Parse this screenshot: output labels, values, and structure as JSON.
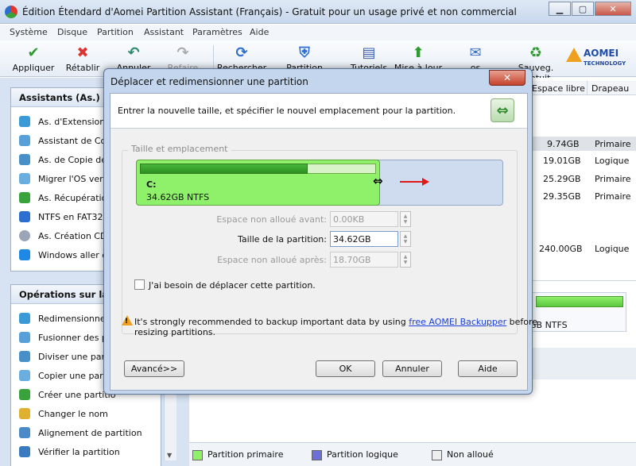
{
  "window": {
    "title": "Édition Étendard d'Aomei Partition Assistant (Français) - Gratuit pour un usage privé et non commercial"
  },
  "menu": [
    "Système",
    "Disque",
    "Partition",
    "Assistant",
    "Paramètres",
    "Aide"
  ],
  "toolbar": {
    "apply": "Appliquer",
    "reset": "Rétablir",
    "undo": "Annuler",
    "redo": "Refaire",
    "search": "Rechercher",
    "secure": "Partition Sécuris.",
    "tutorials": "Tutoriels",
    "update": "Mise à Jour",
    "comment": "os commentaire",
    "backup": "Sauveg. gratuit",
    "brand": "AOMEI",
    "brand_sub": "TECHNOLOGY"
  },
  "sidebar": {
    "wizards_title": "Assistants (As.)",
    "wizards": [
      "As. d'Extension",
      "Assistant de Cop",
      "As. de Copie de",
      "Migrer l'OS vers",
      "As. Récupératio",
      "NTFS en FAT32",
      "As. Création CD",
      "Windows aller cr"
    ],
    "ops_title": "Opérations sur la parti",
    "ops": [
      "Redimensionner",
      "Fusionner des pa",
      "Diviser une parti",
      "Copier une parti",
      "Créer une partitio",
      "Changer le nom",
      "Alignement de partition",
      "Vérifier la partition"
    ]
  },
  "table": {
    "col_free": "Espace libre",
    "col_flag": "Drapeau",
    "rows": [
      {
        "free": "9.74GB",
        "flag": "Primaire"
      },
      {
        "free": "19.01GB",
        "flag": "Logique"
      },
      {
        "free": "25.29GB",
        "flag": "Primaire"
      },
      {
        "free": "29.35GB",
        "flag": "Primaire"
      },
      {
        "free": "240.00GB",
        "flag": "Logique"
      }
    ],
    "disk_label": "GB NTFS"
  },
  "legend": {
    "primary": "Partition primaire",
    "logical": "Partition logique",
    "unalloc": "Non alloué"
  },
  "dialog": {
    "title": "Déplacer et redimensionner une partition",
    "close": "✕",
    "instruction": "Entrer la nouvelle taille, et spécifier le nouvel emplacement pour la partition.",
    "group_label": "Taille et emplacement",
    "partition_letter": "C:",
    "partition_size": "34.62GB NTFS",
    "used_fraction": 0.71,
    "before_label": "Espace non alloué avant:",
    "before_value": "0.00KB",
    "size_label": "Taille de la partition:",
    "size_value": "34.62GB",
    "after_label": "Espace non alloué après:",
    "after_value": "18.70GB",
    "move_label": "J'ai besoin de déplacer cette partition.",
    "warning_pre": "It's strongly recommended to backup important data by using",
    "warning_link": "free AOMEI Backupper",
    "warning_post": "before",
    "warning_line2": "resizing partitions.",
    "advanced": "Avancé>>",
    "ok": "OK",
    "cancel": "Annuler",
    "help": "Aide"
  },
  "colors": {
    "primary_partition": "#8ff06a",
    "logical_partition": "#6b6fd6",
    "accent": "#2c8f22"
  }
}
